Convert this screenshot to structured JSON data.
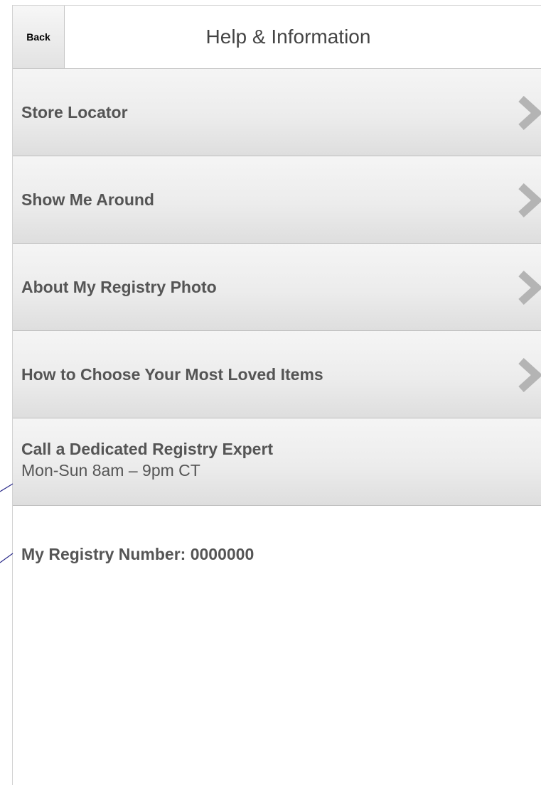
{
  "header": {
    "back_label": "Back",
    "title": "Help & Information"
  },
  "menu": {
    "items": [
      {
        "label": "Store Locator",
        "icon": "chevron-right-icon"
      },
      {
        "label": "Show Me Around",
        "icon": "chevron-right-icon"
      },
      {
        "label": "About My Registry Photo",
        "icon": "chevron-right-icon"
      },
      {
        "label": "How to Choose Your Most Loved Items",
        "icon": "chevron-right-icon"
      }
    ]
  },
  "contact": {
    "title": "Call a Dedicated Registry Expert",
    "hours": "Mon-Sun 8am – 9pm CT"
  },
  "registry": {
    "number_text": "My Registry Number: 0000000"
  },
  "colors": {
    "text": "#555555",
    "title": "#444444",
    "chevron": "#b4b4b4",
    "annotation": "#2b2b8a"
  }
}
